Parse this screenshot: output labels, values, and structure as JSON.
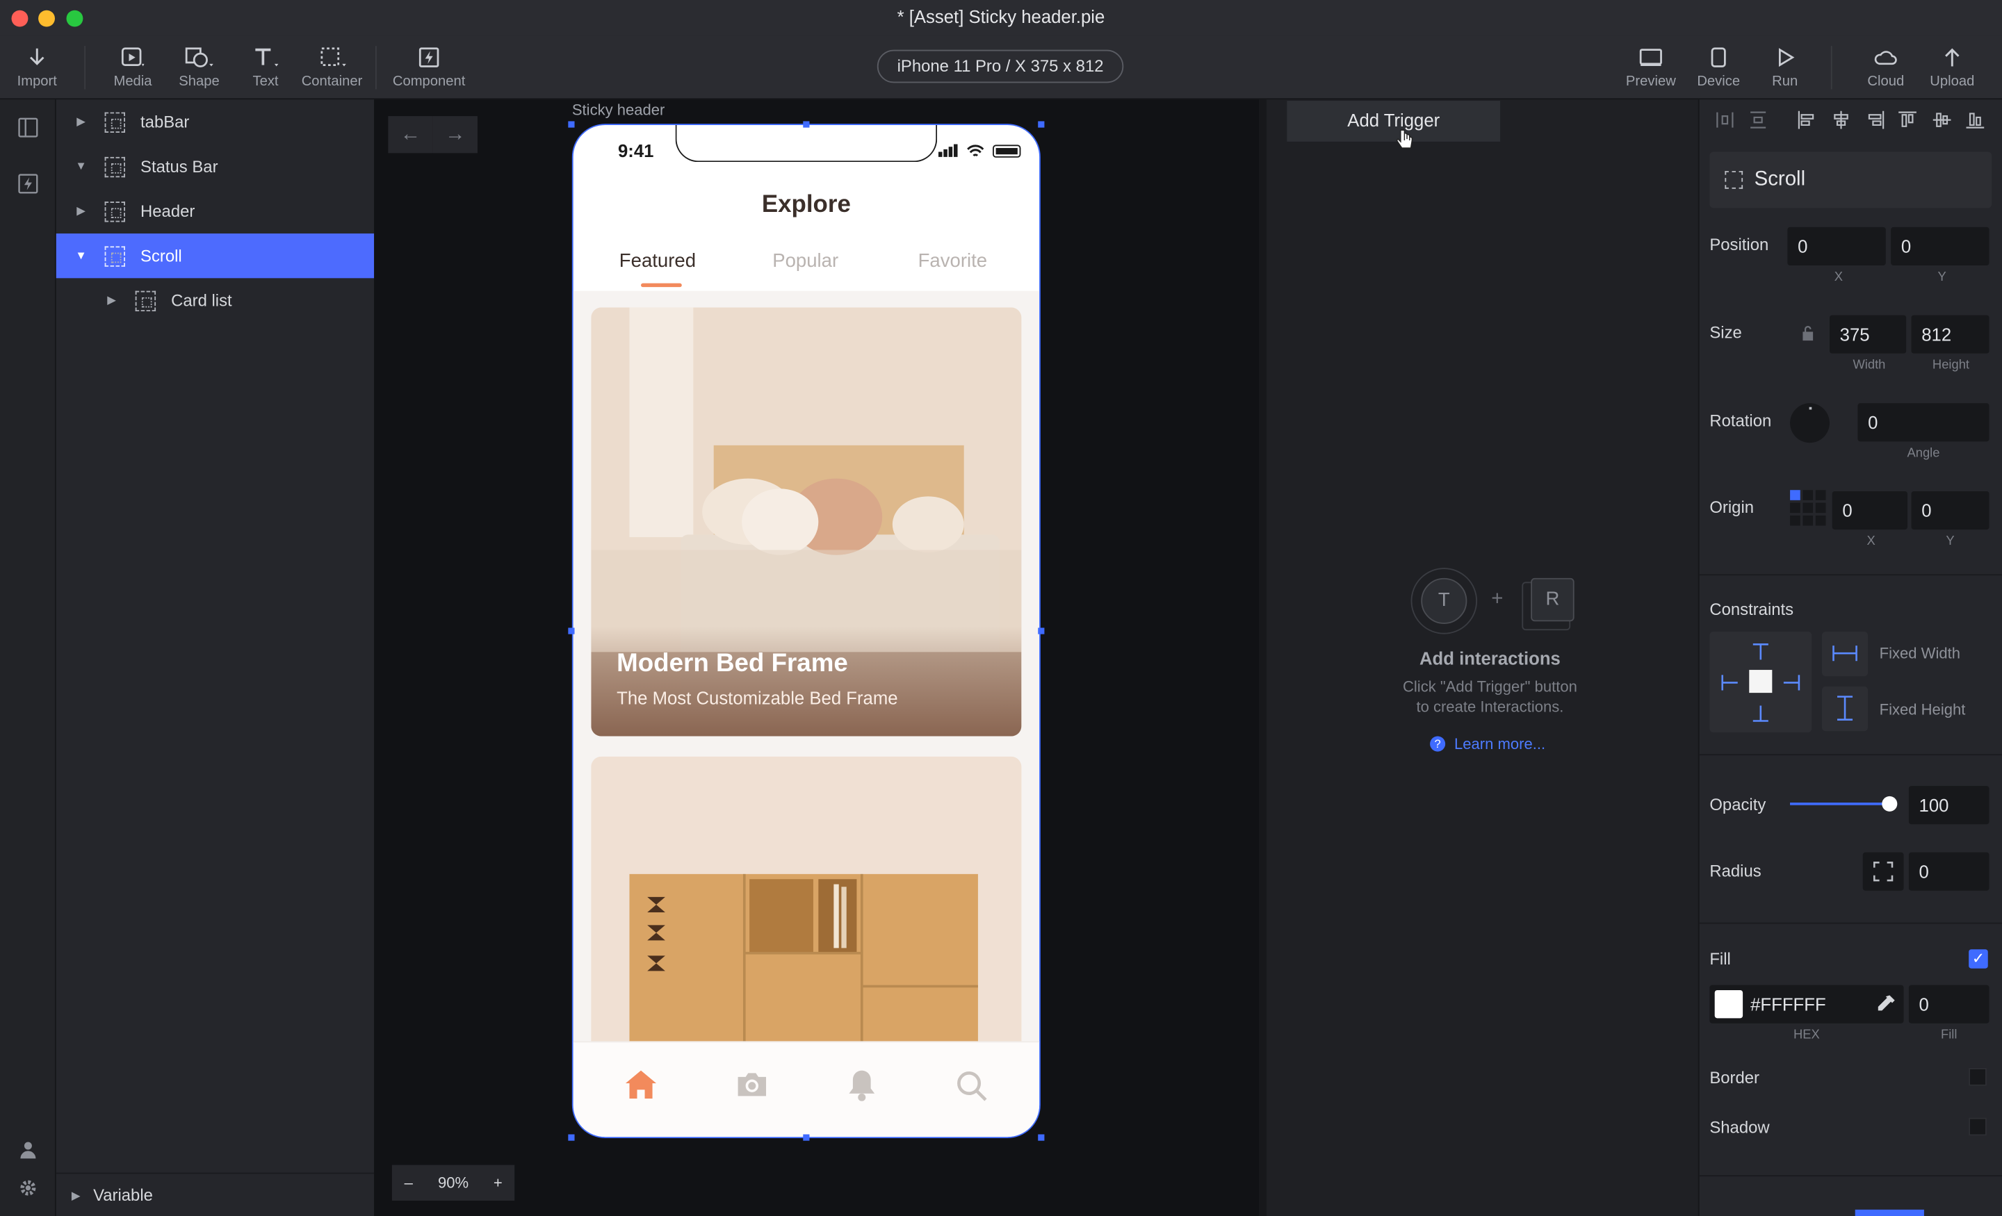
{
  "window": {
    "title": "* [Asset] Sticky header.pie"
  },
  "toolbar": {
    "import": "Import",
    "media": "Media",
    "shape": "Shape",
    "text": "Text",
    "container": "Container",
    "component": "Component",
    "device": "iPhone 11 Pro / X  375 x 812",
    "preview": "Preview",
    "device_btn": "Device",
    "run": "Run",
    "cloud": "Cloud",
    "upload": "Upload"
  },
  "layers": {
    "items": [
      {
        "label": "tabBar",
        "expanded": false
      },
      {
        "label": "Status Bar",
        "expanded": true
      },
      {
        "label": "Header",
        "expanded": false
      },
      {
        "label": "Scroll",
        "expanded": true,
        "selected": true
      },
      {
        "label": "Card list",
        "expanded": false,
        "child": true
      }
    ],
    "variable": "Variable"
  },
  "canvas": {
    "frame_label": "Sticky header",
    "zoom": "90%",
    "zoom_out": "–",
    "zoom_in": "+",
    "back_arrow": "←",
    "forward_arrow": "→"
  },
  "phone": {
    "time": "9:41",
    "title": "Explore",
    "tabs": [
      "Featured",
      "Popular",
      "Favorite"
    ],
    "active_tab": 0,
    "card1": {
      "title": "Modern Bed Frame",
      "subtitle": "The Most Customizable Bed Frame"
    },
    "nav_icons": [
      "home-icon",
      "camera-icon",
      "bell-icon",
      "search-icon"
    ],
    "accent": "#F28A5C"
  },
  "trigger": {
    "add_trigger": "Add Trigger",
    "t": "T",
    "plus": "+",
    "r": "R",
    "title": "Add interactions",
    "desc1": "Click \"Add Trigger\" button",
    "desc2": "to create Interactions.",
    "learn": "Learn more..."
  },
  "props": {
    "layer_name": "Scroll",
    "position_label": "Position",
    "pos_x": "0",
    "pos_y": "0",
    "x": "X",
    "y": "Y",
    "size_label": "Size",
    "width": "375",
    "height": "812",
    "width_label": "Width",
    "height_label": "Height",
    "rotation_label": "Rotation",
    "angle": "0",
    "angle_label": "Angle",
    "origin_label": "Origin",
    "origin_x": "0",
    "origin_y": "0",
    "constraints_label": "Constraints",
    "fixed_width": "Fixed Width",
    "fixed_height": "Fixed Height",
    "opacity_label": "Opacity",
    "opacity": "100",
    "opacity_level": 1.0,
    "radius_label": "Radius",
    "radius": "0",
    "fill_label": "Fill",
    "fill_checked": true,
    "hex": "#FFFFFF",
    "fill_value": "0",
    "hex_label": "HEX",
    "fill_sub": "Fill",
    "border_label": "Border",
    "shadow_label": "Shadow"
  },
  "colors": {
    "selection": "#4D6BFE",
    "accent": "#3F6BFF"
  }
}
